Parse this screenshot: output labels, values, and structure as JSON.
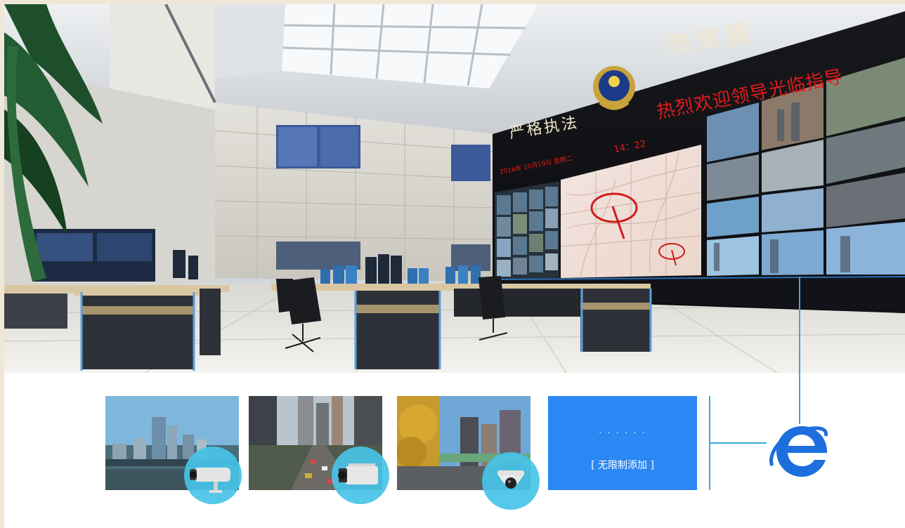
{
  "wall": {
    "slogan_left": "严格执法",
    "slogan_right": "热情服",
    "ticker_welcome": "热烈欢迎领导光临指导",
    "ticker_time": "14：22",
    "ticker_date": "2016年 10月19日 星期二"
  },
  "features": {
    "add_dots": ". . .   . . .",
    "add_label": "[ 无限制添加 ]"
  },
  "icons": {
    "camera_1": "bullet-camera-icon",
    "camera_2": "box-camera-icon",
    "camera_3": "dome-camera-icon",
    "browser": "internet-explorer-icon",
    "emblem": "police-emblem-icon"
  },
  "colors": {
    "accent_blue": "#2b87f3",
    "badge_cyan": "#48c4e8",
    "ticker_red": "#e41b1b",
    "ie_blue": "#1c6fdc"
  }
}
